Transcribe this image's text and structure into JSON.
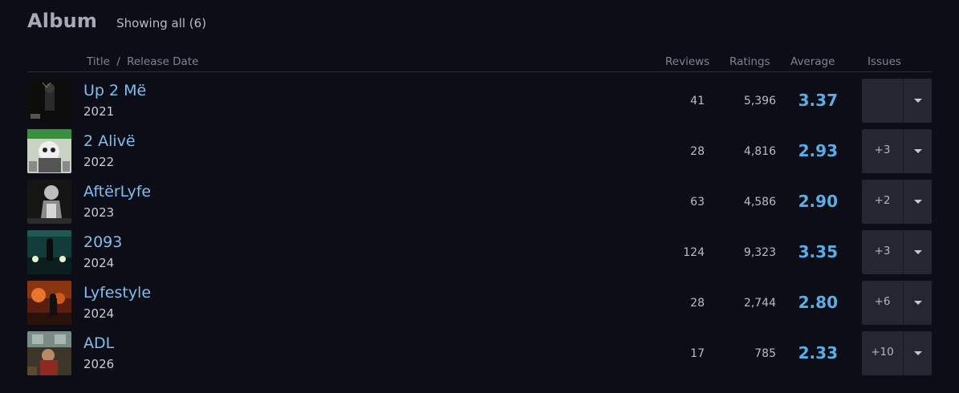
{
  "header": {
    "title": "Album",
    "showing": "Showing all (6)"
  },
  "columns": {
    "title": "Title",
    "sep": "/",
    "release_date": "Release Date",
    "reviews": "Reviews",
    "ratings": "Ratings",
    "average": "Average",
    "issues": "Issues"
  },
  "colors": {
    "title_link": "#7fbfee",
    "average": "#5aaee6",
    "background": "#0c0d16"
  },
  "albums": [
    {
      "title": "Up 2 Më",
      "year": "2021",
      "reviews": "41",
      "ratings": "5,396",
      "average": "3.37",
      "issues": "",
      "cover_icon": "album-cover-up2me"
    },
    {
      "title": "2 Alivë",
      "year": "2022",
      "reviews": "28",
      "ratings": "4,816",
      "average": "2.93",
      "issues": "+3",
      "cover_icon": "album-cover-2alive"
    },
    {
      "title": "AftërLyfe",
      "year": "2023",
      "reviews": "63",
      "ratings": "4,586",
      "average": "2.90",
      "issues": "+2",
      "cover_icon": "album-cover-afterlyfe"
    },
    {
      "title": "2093",
      "year": "2024",
      "reviews": "124",
      "ratings": "9,323",
      "average": "3.35",
      "issues": "+3",
      "cover_icon": "album-cover-2093"
    },
    {
      "title": "Lyfestyle",
      "year": "2024",
      "reviews": "28",
      "ratings": "2,744",
      "average": "2.80",
      "issues": "+6",
      "cover_icon": "album-cover-lyfestyle"
    },
    {
      "title": "ADL",
      "year": "2026",
      "reviews": "17",
      "ratings": "785",
      "average": "2.33",
      "issues": "+10",
      "cover_icon": "album-cover-adl"
    }
  ]
}
